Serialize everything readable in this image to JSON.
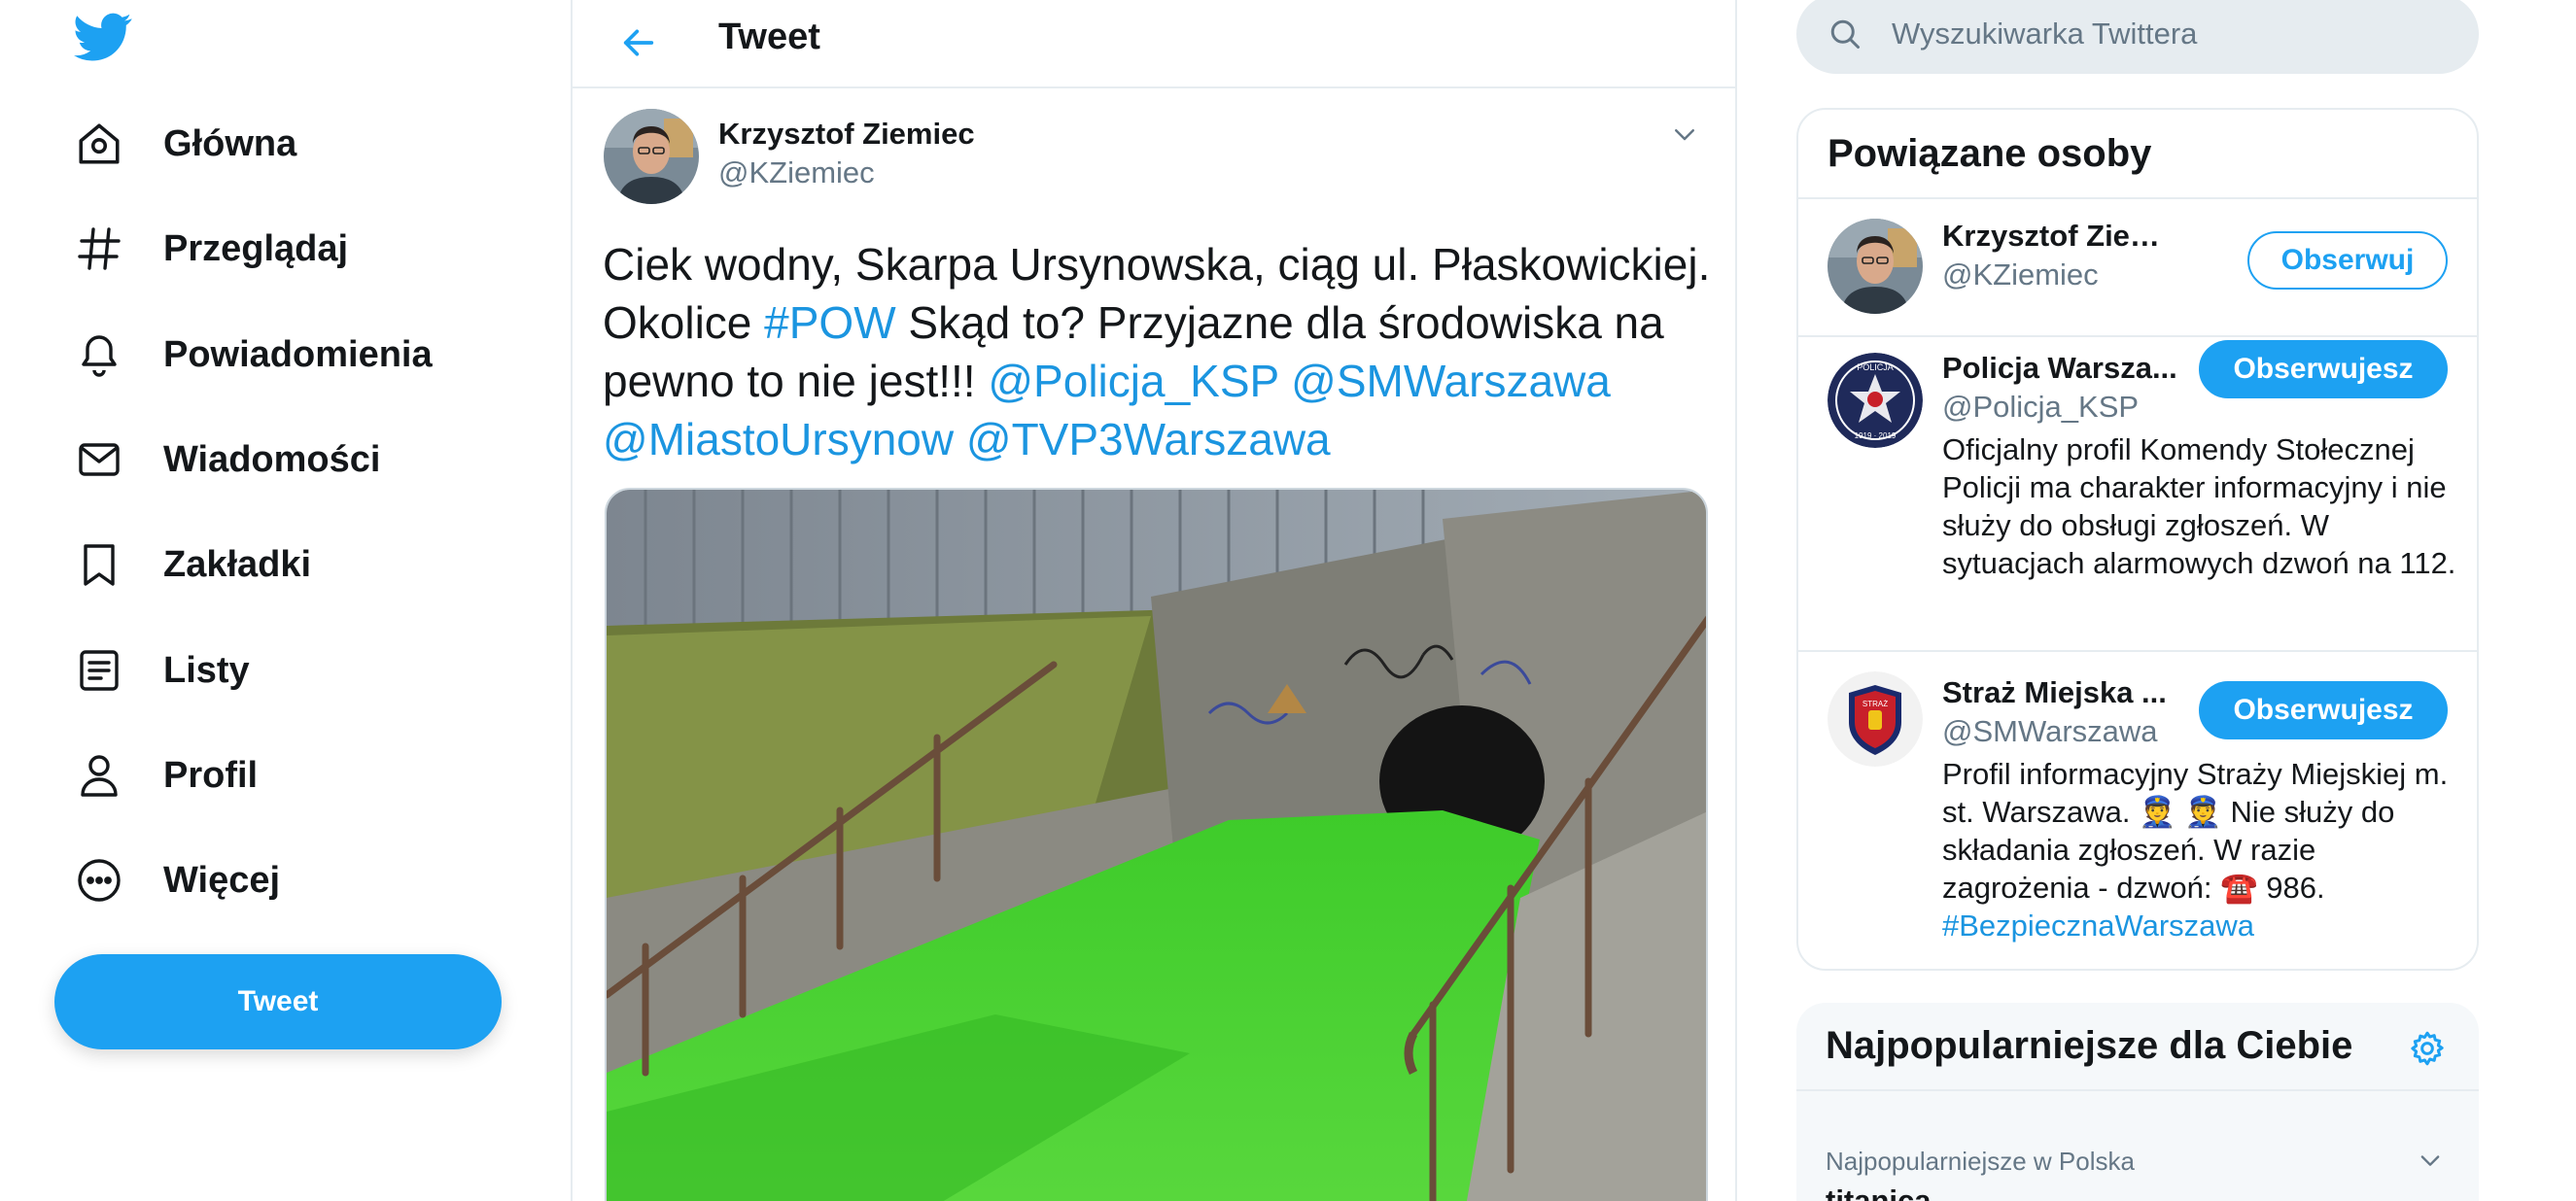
{
  "colors": {
    "accent": "#1da1f2",
    "link": "#1b95e0",
    "text": "#14171a",
    "secondary_text": "#657786",
    "border": "#e6ecf0"
  },
  "sidebar": {
    "logo_icon": "twitter-bird-icon",
    "items": [
      {
        "label": "Główna",
        "icon": "home-icon"
      },
      {
        "label": "Przeglądaj",
        "icon": "hashtag-icon"
      },
      {
        "label": "Powiadomienia",
        "icon": "bell-icon"
      },
      {
        "label": "Wiadomości",
        "icon": "envelope-icon"
      },
      {
        "label": "Zakładki",
        "icon": "bookmark-icon"
      },
      {
        "label": "Listy",
        "icon": "list-icon"
      },
      {
        "label": "Profil",
        "icon": "person-icon"
      },
      {
        "label": "Więcej",
        "icon": "more-circle-icon"
      }
    ],
    "tweet_button": "Tweet"
  },
  "main": {
    "title": "Tweet",
    "tweet": {
      "author_name": "Krzysztof Ziemiec",
      "author_handle": "@KZiemiec",
      "text_parts": [
        {
          "t": "Ciek wodny, Skarpa Ursynowska, ciąg ul. Płaskowickiej. Okolice ",
          "link": false
        },
        {
          "t": "#POW",
          "link": true
        },
        {
          "t": " Skąd to? Przyjazne dla środowiska na pewno to nie jest!!! ",
          "link": false
        },
        {
          "t": "@Policja_KSP",
          "link": true
        },
        {
          "t": " ",
          "link": false
        },
        {
          "t": "@SMWarszawa",
          "link": true
        },
        {
          "t": " ",
          "link": false
        },
        {
          "t": "@MiastoUrsynow",
          "link": true
        },
        {
          "t": " ",
          "link": false
        },
        {
          "t": "@TVP3Warszawa",
          "link": true
        }
      ]
    }
  },
  "right": {
    "search_placeholder": "Wyszukiwarka Twittera",
    "related": {
      "title": "Powiązane osoby",
      "people": [
        {
          "name": "Krzysztof Ziemiec",
          "handle": "@KZiemiec",
          "button": "Obserwuj",
          "bio": ""
        },
        {
          "name": "Policja Warsza...",
          "handle": "@Policja_KSP",
          "button": "Obserwujesz",
          "bio": "Oficjalny profil Komendy Stołecznej Policji ma charakter informacyjny i nie służy do obsługi zgłoszeń. W sytuacjach alarmowych dzwoń na 112."
        },
        {
          "name": "Straż Miejska ...",
          "handle": "@SMWarszawa",
          "button": "Obserwujesz",
          "bio_parts": [
            {
              "t": "Profil informacyjny Straży Miejskiej m. st. Warszawa. 👮 👮 Nie służy do składania zgłoszeń. W razie zagrożenia - dzwoń: ☎️ 986. ",
              "link": false
            },
            {
              "t": "#BezpiecznaWarszawa",
              "link": true
            }
          ]
        }
      ]
    },
    "trends": {
      "title": "Najpopularniejsze dla Ciebie",
      "items": [
        {
          "context": "Najpopularniejsze w Polska",
          "name": "titanica"
        }
      ]
    }
  }
}
